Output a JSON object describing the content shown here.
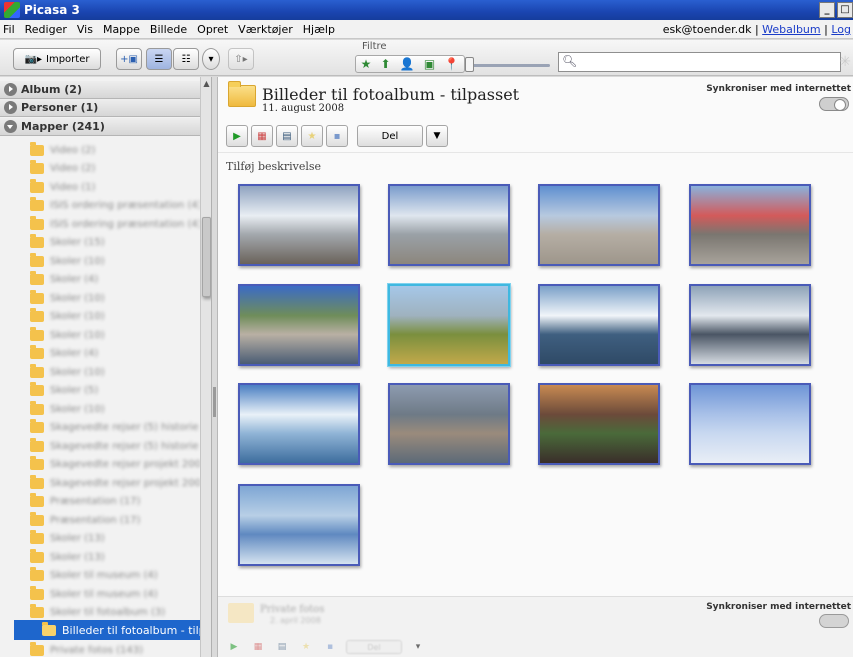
{
  "window": {
    "title": "Picasa 3",
    "minimize": "_",
    "restore": "□"
  },
  "menu": {
    "items": [
      "Fil",
      "Rediger",
      "Vis",
      "Mappe",
      "Billede",
      "Opret",
      "Værktøjer",
      "Hjælp"
    ],
    "user_email": "esk@toender.dk",
    "separator": "|",
    "webalbum": "Webalbum",
    "logout": "Log"
  },
  "toolbar": {
    "import_label": "Importer",
    "filter_label": "Filtre",
    "search_placeholder": ""
  },
  "sidebar": {
    "sections": [
      {
        "label": "Album (2)",
        "expanded": false
      },
      {
        "label": "Personer (1)",
        "expanded": false
      },
      {
        "label": "Mapper (241)",
        "expanded": true
      }
    ],
    "folders": [
      "Video (2)",
      "Video (2)",
      "Video (1)",
      "ISIS ordering præsentation (4)",
      "ISIS ordering præsentation (4)",
      "Skoler (15)",
      "Skoler (10)",
      "Skoler (4)",
      "Skoler (10)",
      "Skoler (10)",
      "Skoler (10)",
      "Skoler (4)",
      "Skoler (10)",
      "Skoler (5)",
      "Skoler (10)",
      "Skagevedte rejser (5) historie",
      "Skagevedte rejser (5) historie",
      "Skagevedte rejser projekt 2008",
      "Skagevedte rejser projekt 2008",
      "Præsentation (17)",
      "Præsentation (17)",
      "Skoler (13)",
      "Skoler (13)",
      "Skoler til museum (4)",
      "Skoler til museum (4)",
      "Skoler til fotoalbum (3)"
    ],
    "selected_folder": "Billeder til fotoalbum - tilpasset...",
    "after_selected": "Private fotos (143)"
  },
  "album": {
    "title": "Billeder til fotoalbum - tilpasset",
    "date": "11. august 2008",
    "sync_label": "Synkroniser med internettet",
    "share_label": "Del",
    "add_description": "Tilføj beskrivelse"
  },
  "thumbnails": [
    {
      "name": "glacier-front-rocks",
      "colors": [
        "#8fa3c0",
        "#e9eef3",
        "#a3a8ad",
        "#6a625a"
      ]
    },
    {
      "name": "glacier-wall-gravel",
      "colors": [
        "#7a9ccc",
        "#dfe6ee",
        "#9aa1a7",
        "#8c867d"
      ]
    },
    {
      "name": "tundra-vehicle",
      "colors": [
        "#5f8fd0",
        "#b7c9df",
        "#b5aea4",
        "#9e968b"
      ]
    },
    {
      "name": "red-plane-airfield",
      "colors": [
        "#8ab1dc",
        "#d35a5a",
        "#7a7670",
        "#a8a39b"
      ]
    },
    {
      "name": "town-on-rocks",
      "colors": [
        "#3b6bc5",
        "#6f8d5a",
        "#b9b0a4",
        "#4a5c74"
      ]
    },
    {
      "name": "meadow-fjord",
      "colors": [
        "#a5c7e8",
        "#9fb2bf",
        "#7a8f3e",
        "#c2a94a"
      ]
    },
    {
      "name": "iceberg-sea",
      "colors": [
        "#7aa0c8",
        "#f1f5f9",
        "#3f5f80",
        "#2f4a66"
      ]
    },
    {
      "name": "iceberg-silver-water",
      "colors": [
        "#8ea3b8",
        "#e3e8ee",
        "#4a5564",
        "#d5dbe2"
      ]
    },
    {
      "name": "arch-iceberg",
      "colors": [
        "#4a7fc2",
        "#e9f1f8",
        "#90b4d6",
        "#3d6d9e"
      ]
    },
    {
      "name": "coastal-town-mountain",
      "colors": [
        "#8d9bb0",
        "#6e7a86",
        "#9a8b7c",
        "#5c6a78"
      ]
    },
    {
      "name": "sunset-tents",
      "colors": [
        "#c88a52",
        "#6b4a3a",
        "#4a6a3a",
        "#3a2e2a"
      ]
    },
    {
      "name": "airplane-wing-sky",
      "colors": [
        "#6e95d6",
        "#a9c1e8",
        "#c8d8f0",
        "#e9eef6"
      ]
    },
    {
      "name": "aerial-ice-sea",
      "colors": [
        "#7ea6d4",
        "#b8cfe6",
        "#5f89c0",
        "#d5e3f0"
      ]
    }
  ],
  "next_album": {
    "title": "Private fotos",
    "date": "2. april 2008",
    "sync_label": "Synkroniser med internettet",
    "share_label": "Del"
  }
}
